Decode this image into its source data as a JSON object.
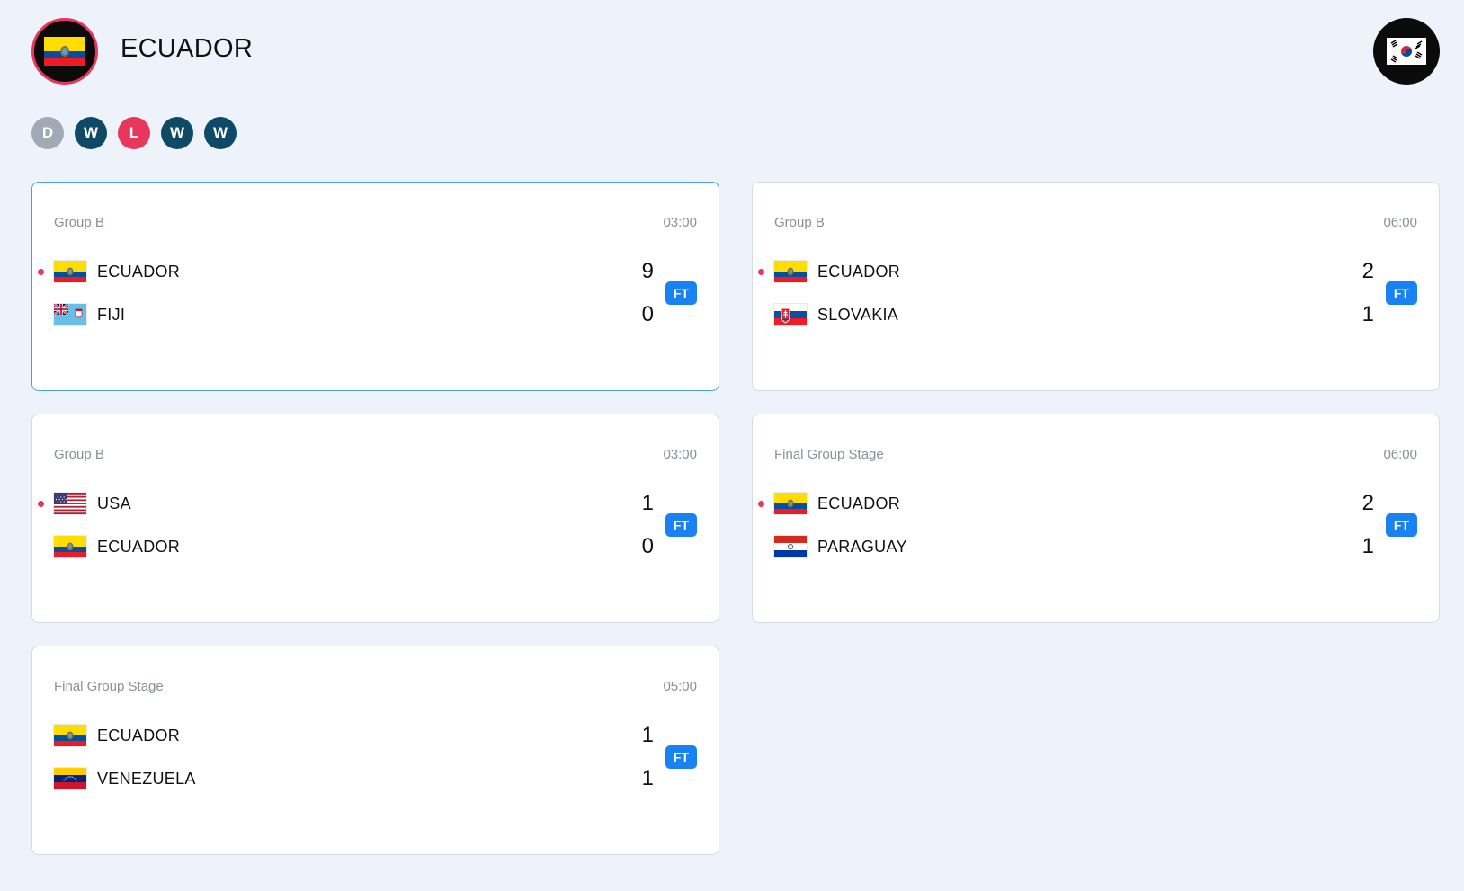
{
  "header": {
    "team_name": "ECUADOR",
    "team_flag": "ecuador-flag-icon",
    "opponent_flag": "south-korea-flag-icon"
  },
  "form": [
    {
      "label": "D",
      "color": "#a2a9b6"
    },
    {
      "label": "W",
      "color": "#0e4a66"
    },
    {
      "label": "L",
      "color": "#e8365d"
    },
    {
      "label": "W",
      "color": "#0e4a66"
    },
    {
      "label": "W",
      "color": "#0e4a66"
    }
  ],
  "matches": [
    {
      "stage": "Group B",
      "time": "03:00",
      "status": "FT",
      "home": {
        "name": "ECUADOR",
        "score": "9",
        "flag": "ecuador-flag-icon",
        "winner": true
      },
      "away": {
        "name": "FIJI",
        "score": "0",
        "flag": "fiji-flag-icon",
        "winner": false
      }
    },
    {
      "stage": "Group B",
      "time": "06:00",
      "status": "FT",
      "home": {
        "name": "ECUADOR",
        "score": "2",
        "flag": "ecuador-flag-icon",
        "winner": true
      },
      "away": {
        "name": "SLOVAKIA",
        "score": "1",
        "flag": "slovakia-flag-icon",
        "winner": false
      }
    },
    {
      "stage": "Group B",
      "time": "03:00",
      "status": "FT",
      "home": {
        "name": "USA",
        "score": "1",
        "flag": "usa-flag-icon",
        "winner": true
      },
      "away": {
        "name": "ECUADOR",
        "score": "0",
        "flag": "ecuador-flag-icon",
        "winner": false
      }
    },
    {
      "stage": "Final Group Stage",
      "time": "06:00",
      "status": "FT",
      "home": {
        "name": "ECUADOR",
        "score": "2",
        "flag": "ecuador-flag-icon",
        "winner": true
      },
      "away": {
        "name": "PARAGUAY",
        "score": "1",
        "flag": "paraguay-flag-icon",
        "winner": false
      }
    },
    {
      "stage": "Final Group Stage",
      "time": "05:00",
      "status": "FT",
      "home": {
        "name": "ECUADOR",
        "score": "1",
        "flag": "ecuador-flag-icon",
        "winner": false
      },
      "away": {
        "name": "VENEZUELA",
        "score": "1",
        "flag": "venezuela-flag-icon",
        "winner": false
      }
    }
  ],
  "colors": {
    "accent": "#1a82f0",
    "highlight": "#e8365d",
    "win": "#0e4a66",
    "draw": "#a2a9b6"
  }
}
